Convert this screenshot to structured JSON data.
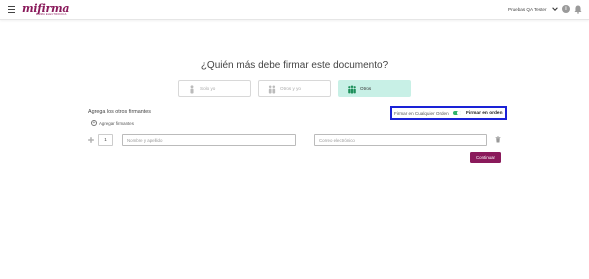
{
  "header": {
    "logo_text": "mifirma",
    "logo_sub": "FIRMA ELECTRONICA",
    "user_name": "Pruebas QA Tester",
    "info_label": "i"
  },
  "main": {
    "title": "¿Quién más debe firmar este documento?",
    "options": [
      {
        "label": "Solo yo",
        "icon": "single-person-icon",
        "selected": false
      },
      {
        "label": "Otros y yo",
        "icon": "two-people-icon",
        "selected": false
      },
      {
        "label": "Otros",
        "icon": "group-icon",
        "selected": true
      }
    ],
    "section_label": "Agrega los otros firmantes",
    "add_signers_label": "Agregar firmantes",
    "order": {
      "any_order_label": "Firmar en Cualquier Orden",
      "in_order_label": "Firmar en orden",
      "toggle_on": true
    },
    "signer_row": {
      "number": "1",
      "name_placeholder": "Nombre y apellido",
      "email_placeholder": "Correo electrónico"
    },
    "continue_label": "Continuar"
  },
  "colors": {
    "brand": "#8a1a5b",
    "selected_option": "#c8f0e6",
    "toggle_on": "#2fb36b",
    "highlight_border": "#1a22d6"
  }
}
